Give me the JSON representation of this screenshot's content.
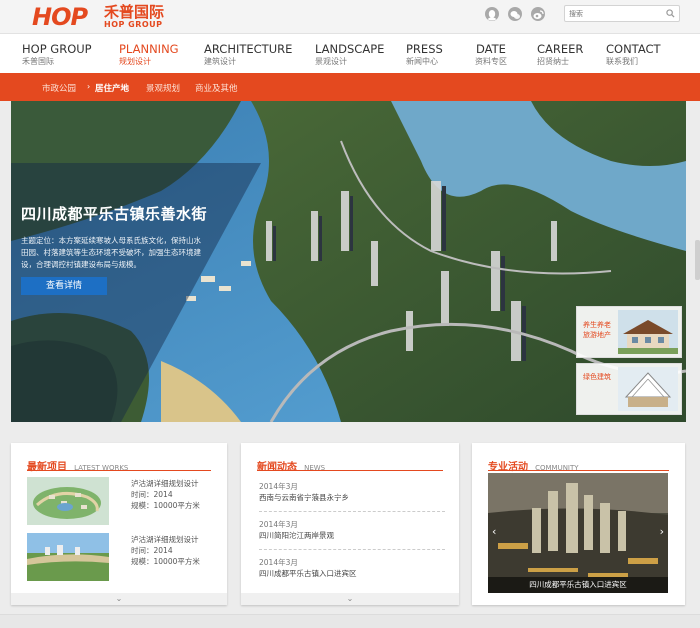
{
  "brand": {
    "logo_text": "HOP",
    "name_cn": "禾普国际",
    "name_en": "HOP GROUP",
    "accent_color": "#e4491f"
  },
  "top_icons": [
    "qq-icon",
    "wechat-icon",
    "weibo-icon"
  ],
  "search": {
    "placeholder": "搜索"
  },
  "nav": [
    {
      "en": "HOP GROUP",
      "cn": "禾普国际"
    },
    {
      "en": "PLANNING",
      "cn": "规划设计",
      "active": true
    },
    {
      "en": "ARCHITECTURE",
      "cn": "建筑设计"
    },
    {
      "en": "LANDSCAPE",
      "cn": "景观设计"
    },
    {
      "en": "PRESS",
      "cn": "新闻中心"
    },
    {
      "en": "DATE",
      "cn": "资料专区"
    },
    {
      "en": "CAREER",
      "cn": "招贤纳士"
    },
    {
      "en": "CONTACT",
      "cn": "联系我们"
    }
  ],
  "subnav": [
    {
      "label": "市政公园"
    },
    {
      "label": "居住产地",
      "active": true
    },
    {
      "label": "景观规划"
    },
    {
      "label": "商业及其他"
    }
  ],
  "hero": {
    "title": "四川成都平乐古镇乐善水街",
    "description": "主题定位：本方案延续寒坡人母系氏族文化，保持山水田园、村落建筑等生态环境不受破坏，加强生态环境建设，合理调控村镇建设布局与规模。",
    "button": "查看详情",
    "thumbs": [
      {
        "label_1": "养生养老",
        "label_2": "旅游地产"
      },
      {
        "label_1": "绿色建筑",
        "label_2": ""
      }
    ]
  },
  "latest_works": {
    "title_cn": "最新项目",
    "title_en": "LATEST WORKS",
    "items": [
      {
        "title": "泸沽湖详细规划设计",
        "time": "时间：2014",
        "scale": "规模：10000平方米"
      },
      {
        "title": "泸沽湖详细规划设计",
        "time": "时间：2014",
        "scale": "规模：10000平方米"
      }
    ],
    "more": "⌄"
  },
  "news": {
    "title_cn": "新闻动态",
    "title_en": "NEWS",
    "items": [
      {
        "date": "2014年3月",
        "title": "西南与云南省宁蒗县永宁乡"
      },
      {
        "date": "2014年3月",
        "title": "四川简阳沱江两岸景观"
      },
      {
        "date": "2014年3月",
        "title": "四川成都平乐古镇入口进宾区"
      }
    ],
    "more": "⌄"
  },
  "community": {
    "title_cn": "专业活动",
    "title_en": "COMMUNITY",
    "caption": "四川成都平乐古镇入口进宾区",
    "prev": "‹",
    "next": "›"
  }
}
